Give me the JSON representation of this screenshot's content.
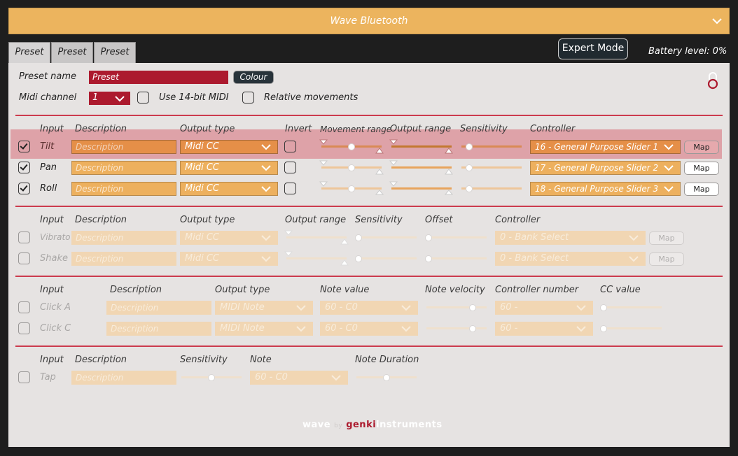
{
  "window": {
    "title": "Wave Bluetooth"
  },
  "tabs": [
    {
      "label": "Preset"
    },
    {
      "label": "Preset"
    },
    {
      "label": "Preset"
    }
  ],
  "expert_mode_label": "Expert Mode",
  "battery_text": "Battery level: 0%",
  "preset": {
    "name_label": "Preset name",
    "name_value": "Preset",
    "colour_label": "Colour",
    "midi_label": "Midi channel",
    "midi_value": "1",
    "use14_label": "Use 14-bit MIDI",
    "relative_label": "Relative movements"
  },
  "motion": {
    "headers": {
      "input": "Input",
      "description": "Description",
      "output_type": "Output type",
      "invert": "Invert",
      "movement_range": "Movement range",
      "output_range": "Output range",
      "sensitivity": "Sensitivity",
      "controller": "Controller"
    },
    "rows": [
      {
        "input": "Tilt",
        "checked": true,
        "description_placeholder": "Description",
        "output_type": "Midi CC",
        "controller": "16 - General Purpose Slider 1",
        "map_label": "Map"
      },
      {
        "input": "Pan",
        "checked": true,
        "description_placeholder": "Description",
        "output_type": "Midi CC",
        "controller": "17 - General Purpose Slider 2",
        "map_label": "Map"
      },
      {
        "input": "Roll",
        "checked": true,
        "description_placeholder": "Description",
        "output_type": "Midi CC",
        "controller": "18 - General Purpose Slider 3",
        "map_label": "Map"
      }
    ]
  },
  "gesture": {
    "headers": {
      "input": "Input",
      "description": "Description",
      "output_type": "Output type",
      "output_range": "Output range",
      "sensitivity": "Sensitivity",
      "offset": "Offset",
      "controller": "Controller"
    },
    "rows": [
      {
        "input": "Vibrato",
        "description_placeholder": "Description",
        "output_type": "Midi CC",
        "controller": "0 - Bank Select",
        "map_label": "Map"
      },
      {
        "input": "Shake",
        "description_placeholder": "Description",
        "output_type": "Midi CC",
        "controller": "0 - Bank Select",
        "map_label": "Map"
      }
    ]
  },
  "click": {
    "headers": {
      "input": "Input",
      "description": "Description",
      "output_type": "Output type",
      "note_value": "Note value",
      "note_velocity": "Note velocity",
      "controller_number": "Controller number",
      "cc_value": "CC value"
    },
    "rows": [
      {
        "input": "Click A",
        "description_placeholder": "Description",
        "output_type": "MIDI Note",
        "note_value": "60 - C0",
        "controller_number": "60 -"
      },
      {
        "input": "Click C",
        "description_placeholder": "Description",
        "output_type": "MIDI Note",
        "note_value": "60 - C0",
        "controller_number": "60 -"
      }
    ]
  },
  "tap": {
    "headers": {
      "input": "Input",
      "description": "Description",
      "sensitivity": "Sensitivity",
      "note": "Note",
      "note_duration": "Note Duration"
    },
    "row": {
      "input": "Tap",
      "description_placeholder": "Description",
      "note": "60 - C0"
    }
  },
  "footer": {
    "wave": "wave",
    "by": "by",
    "genki": "genki",
    "instruments": "instruments"
  },
  "colors": {
    "accent": "#ecb45e",
    "brand_red": "#ac1a2e",
    "panel": "#e6e3e2",
    "background": "#1e1e1e"
  },
  "icons": [
    "chevron-down-icon",
    "checkmark-icon",
    "lock-icon"
  ]
}
